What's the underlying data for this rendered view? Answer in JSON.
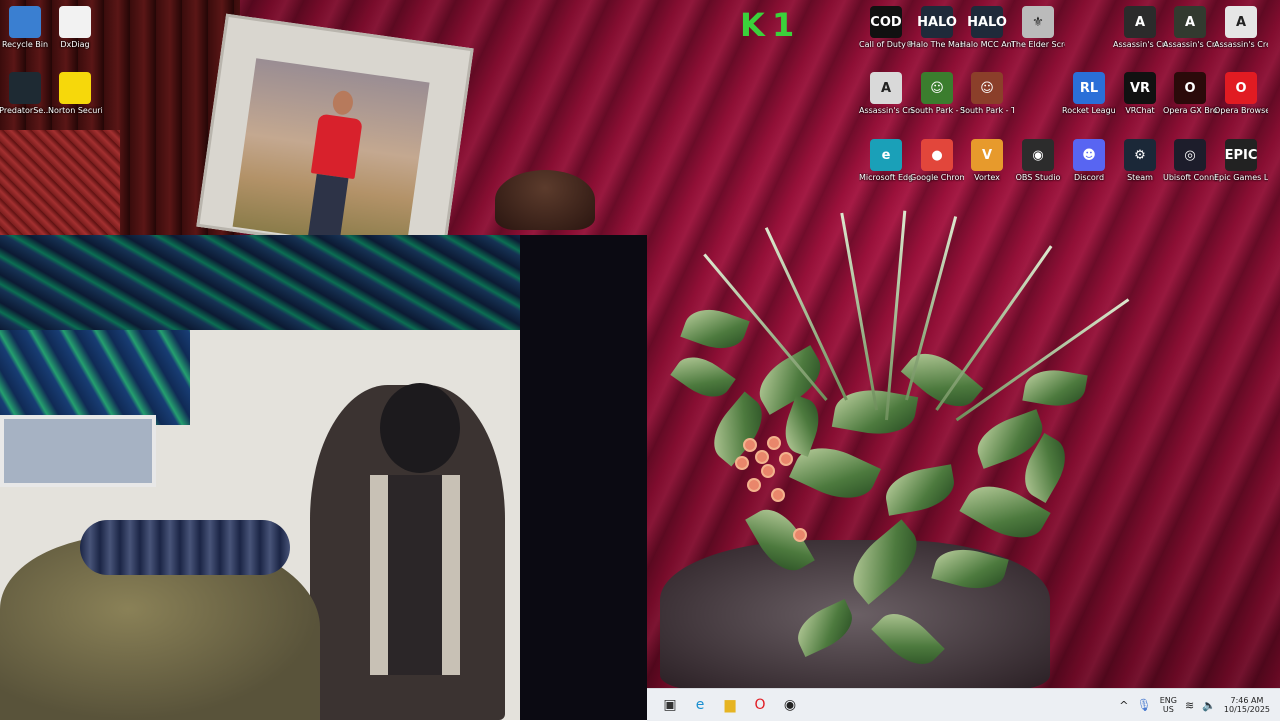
{
  "desktop": {
    "icons_left": [
      {
        "name": "recycle-bin",
        "label": "Recycle Bin",
        "icon": "recycle-bin-icon",
        "color": "#3a7fd1"
      },
      {
        "name": "dxdiag",
        "label": "DxDiag",
        "icon": "document-icon",
        "color": "#f2f2f2"
      },
      {
        "name": "predatorsense",
        "label": "PredatorSe...",
        "icon": "predator-icon",
        "color": "#1e2a33"
      },
      {
        "name": "norton",
        "label": "Norton Security Ultra",
        "icon": "norton-check-icon",
        "color": "#f6d80b"
      }
    ],
    "icons_right": [
      {
        "name": "call-of-duty",
        "label": "Call of Duty®",
        "icon": "call-of-duty-icon",
        "glyph": "COD",
        "color": "#111111"
      },
      {
        "name": "halo-mcc",
        "label": "Halo The Master Chi...",
        "icon": "halo-icon",
        "glyph": "HALO",
        "color": "#1f2a3a"
      },
      {
        "name": "halo-mcc-anticheat",
        "label": "Halo MCC Anti-Che...",
        "icon": "halo-icon",
        "glyph": "HALO",
        "color": "#1f2a3a"
      },
      {
        "name": "elder-scrolls",
        "label": "The Elder Scrolls ...",
        "icon": "dragon-icon",
        "glyph": "⚜",
        "color": "#bbbbbb"
      },
      {
        "name": "ac-mirage",
        "label": "Assassin's Creed Mirage",
        "icon": "assassins-creed-icon",
        "glyph": "A",
        "color": "#2b2b2b"
      },
      {
        "name": "ac-odyssey",
        "label": "Assassin's Creed O...",
        "icon": "assassins-creed-icon",
        "glyph": "A",
        "color": "#323a2f"
      },
      {
        "name": "ac-3",
        "label": "Assassin's Creed® ...",
        "icon": "assassins-creed-icon",
        "glyph": "A",
        "color": "#e6e6e6"
      },
      {
        "name": "ac-unity",
        "label": "Assassin's Creed Unity",
        "icon": "assassins-creed-icon",
        "glyph": "A",
        "color": "#d9d9d9"
      },
      {
        "name": "south-park-tsot",
        "label": "South Park - TSOT",
        "icon": "south-park-icon",
        "glyph": "☺",
        "color": "#3b7d2e"
      },
      {
        "name": "south-park-fbw",
        "label": "South Park - The Fractur...",
        "icon": "south-park-icon",
        "glyph": "☺",
        "color": "#8b3f2a"
      },
      {
        "name": "rocket-league",
        "label": "Rocket League®",
        "icon": "rocket-league-icon",
        "glyph": "RL",
        "color": "#2a6fd8"
      },
      {
        "name": "vrchat",
        "label": "VRChat",
        "icon": "vrchat-icon",
        "glyph": "VR",
        "color": "#111111"
      },
      {
        "name": "opera-gx",
        "label": "Opera GX Browser",
        "icon": "opera-gx-icon",
        "glyph": "O",
        "color": "#2b0a0a"
      },
      {
        "name": "opera",
        "label": "Opera Browser",
        "icon": "opera-icon",
        "glyph": "O",
        "color": "#e11b22"
      },
      {
        "name": "edge",
        "label": "Microsoft Edge",
        "icon": "edge-icon",
        "glyph": "e",
        "color": "#1aa0b8"
      },
      {
        "name": "chrome",
        "label": "Google Chrome",
        "icon": "chrome-icon",
        "glyph": "●",
        "color": "#e2463b"
      },
      {
        "name": "vortex",
        "label": "Vortex",
        "icon": "vortex-icon",
        "glyph": "V",
        "color": "#e79a2c"
      },
      {
        "name": "obs",
        "label": "OBS Studio",
        "icon": "obs-icon",
        "glyph": "◉",
        "color": "#2c2c2c"
      },
      {
        "name": "discord",
        "label": "Discord",
        "icon": "discord-icon",
        "glyph": "☻",
        "color": "#5865f2"
      },
      {
        "name": "steam",
        "label": "Steam",
        "icon": "steam-icon",
        "glyph": "⚙",
        "color": "#1b2838"
      },
      {
        "name": "ubisoft",
        "label": "Ubisoft Connect",
        "icon": "ubisoft-icon",
        "glyph": "◎",
        "color": "#1d1d2b"
      },
      {
        "name": "epic",
        "label": "Epic Games Launcher",
        "icon": "epic-games-icon",
        "glyph": "EPIC",
        "color": "#222222"
      }
    ]
  },
  "overlay": {
    "k_logo": "K 1"
  },
  "taskbar": {
    "pinned": [
      {
        "name": "task-view",
        "icon": "task-view-icon",
        "glyph": "▣"
      },
      {
        "name": "edge",
        "icon": "edge-icon",
        "glyph": "e"
      },
      {
        "name": "file-explorer",
        "icon": "folder-icon",
        "glyph": "▆"
      },
      {
        "name": "opera",
        "icon": "opera-icon",
        "glyph": "O"
      },
      {
        "name": "obs",
        "icon": "obs-icon",
        "glyph": "◉"
      }
    ],
    "tray": {
      "language_top": "ENG",
      "language_bottom": "US",
      "time": "7:46 AM",
      "date": "10/15/2025"
    }
  }
}
